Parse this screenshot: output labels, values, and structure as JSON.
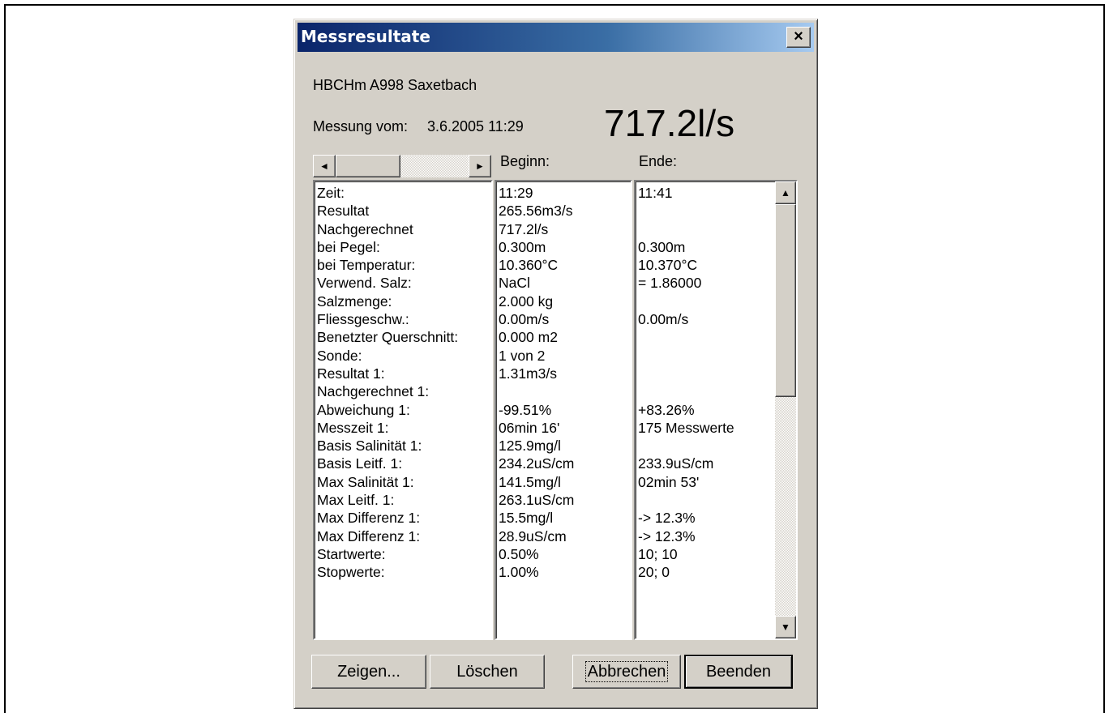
{
  "dialog": {
    "title": "Messresultate",
    "close_label": "×",
    "station": "HBCHm A998 Saxetbach",
    "measurement_label": "Messung vom:",
    "measurement_datetime": "3.6.2005 11:29",
    "result_big": "717.2l/s",
    "header_begin": "Beginn:",
    "header_end": "Ende:"
  },
  "table": {
    "labels": [
      "Zeit:",
      "Resultat",
      "Nachgerechnet",
      "bei Pegel:",
      "bei Temperatur:",
      "Verwend. Salz:",
      "Salzmenge:",
      "Fliessgeschw.:",
      "Benetzter Querschnitt:",
      "Sonde:",
      "Resultat 1:",
      "Nachgerechnet 1:",
      "Abweichung 1:",
      "Messzeit 1:",
      "Basis Salinität 1:",
      "Basis Leitf. 1:",
      "Max Salinität 1:",
      "Max Leitf. 1:",
      "Max Differenz 1:",
      "Max Differenz 1:",
      "Startwerte:",
      "Stopwerte:"
    ],
    "begin": [
      "11:29",
      "265.56m3/s",
      "717.2l/s",
      "0.300m",
      "10.360°C",
      "NaCl",
      "2.000 kg",
      "0.00m/s",
      "0.000 m2",
      "1 von 2",
      "1.31m3/s",
      "",
      "-99.51%",
      "06min 16'",
      "125.9mg/l",
      "234.2uS/cm",
      "141.5mg/l",
      "263.1uS/cm",
      "15.5mg/l",
      "28.9uS/cm",
      "0.50%",
      "1.00%"
    ],
    "end": [
      "11:41",
      "",
      "",
      "0.300m",
      "10.370°C",
      "= 1.86000",
      "",
      "0.00m/s",
      "",
      "",
      "",
      "",
      "+83.26%",
      "175 Messwerte",
      "",
      "233.9uS/cm",
      "02min 53'",
      "",
      "-> 12.3%",
      "-> 12.3%",
      "10; 10",
      "20; 0"
    ]
  },
  "scroll": {
    "left_arrow": "◄",
    "right_arrow": "►",
    "up_arrow": "▲",
    "down_arrow": "▼"
  },
  "buttons": {
    "show": "Zeigen...",
    "delete": "Löschen",
    "cancel": "Abbrechen",
    "finish": "Beenden"
  }
}
